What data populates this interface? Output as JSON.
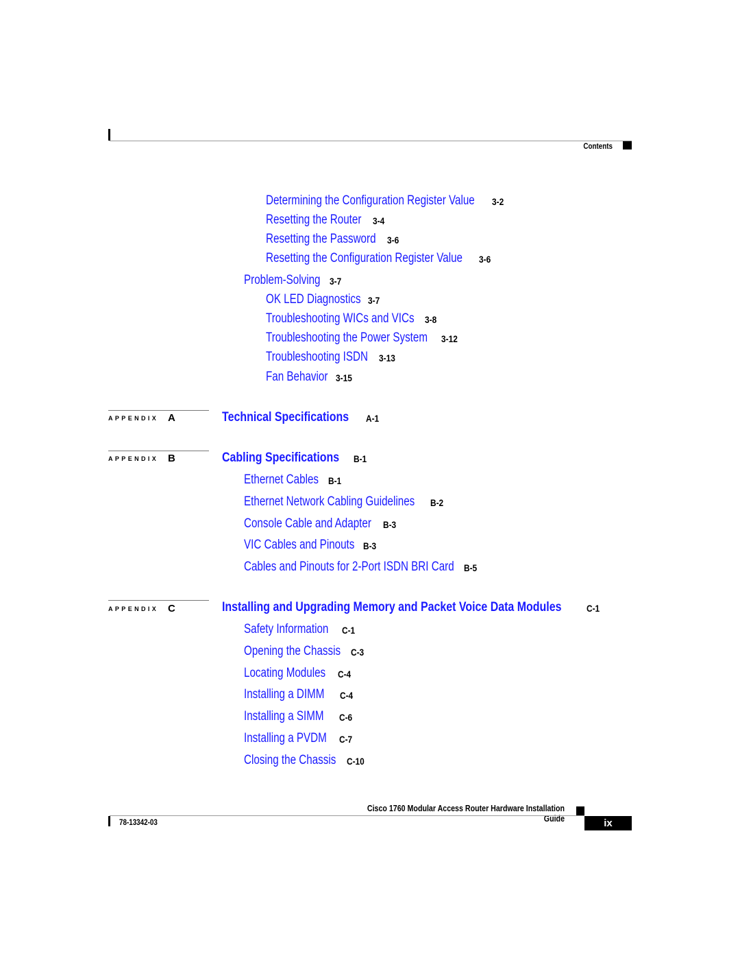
{
  "header": {
    "section": "Contents"
  },
  "entries_top": [
    {
      "title": "Determining the Configuration Register Value",
      "page": "3-2"
    },
    {
      "title": "Resetting the Router",
      "page": "3-4"
    },
    {
      "title": "Resetting the Password",
      "page": "3-6"
    },
    {
      "title": "Resetting the Configuration Register Value",
      "page": "3-6"
    }
  ],
  "problem_solving": {
    "title": "Problem-Solving",
    "page": "3-7",
    "items": [
      {
        "title": "OK LED Diagnostics",
        "page": "3-7"
      },
      {
        "title": "Troubleshooting WICs and VICs",
        "page": "3-8"
      },
      {
        "title": "Troubleshooting the Power System",
        "page": "3-12"
      },
      {
        "title": "Troubleshooting ISDN",
        "page": "3-13"
      },
      {
        "title": "Fan Behavior",
        "page": "3-15"
      }
    ]
  },
  "appendix_a": {
    "label": "APPENDIX",
    "letter": "A",
    "title": "Technical Specifications",
    "page": "A-1"
  },
  "appendix_b": {
    "label": "APPENDIX",
    "letter": "B",
    "title": "Cabling Specifications",
    "page": "B-1",
    "items": [
      {
        "title": "Ethernet Cables",
        "page": "B-1"
      },
      {
        "title": "Ethernet Network Cabling Guidelines",
        "page": "B-2"
      },
      {
        "title": "Console Cable and Adapter",
        "page": "B-3"
      },
      {
        "title": "VIC Cables and Pinouts",
        "page": "B-3"
      },
      {
        "title": "Cables and Pinouts for 2-Port ISDN BRI Card",
        "page": "B-5"
      }
    ]
  },
  "appendix_c": {
    "label": "APPENDIX",
    "letter": "C",
    "title": "Installing and Upgrading Memory and Packet Voice Data Modules",
    "page": "C-1",
    "items": [
      {
        "title": "Safety Information",
        "page": "C-1"
      },
      {
        "title": "Opening the Chassis",
        "page": "C-3"
      },
      {
        "title": "Locating Modules",
        "page": "C-4"
      },
      {
        "title": "Installing a DIMM",
        "page": "C-4"
      },
      {
        "title": "Installing a SIMM",
        "page": "C-6"
      },
      {
        "title": "Installing a PVDM",
        "page": "C-7"
      },
      {
        "title": "Closing the Chassis",
        "page": "C-10"
      }
    ]
  },
  "footer": {
    "book_title": "Cisco 1760 Modular Access Router Hardware Installation Guide",
    "doc_number": "78-13342-03",
    "page_number": "ix"
  }
}
